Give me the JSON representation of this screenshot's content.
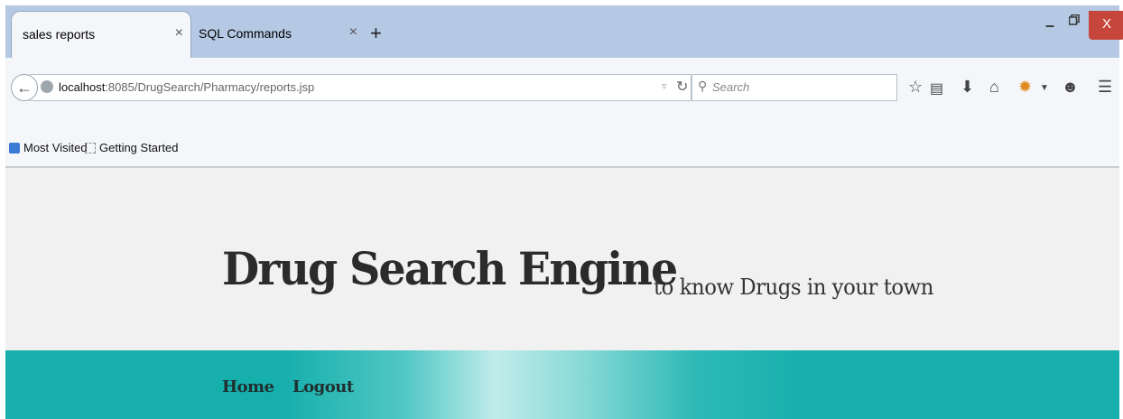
{
  "tabs": [
    {
      "label": "sales reports",
      "close": "×"
    },
    {
      "label": "SQL Commands",
      "close": "×"
    }
  ],
  "new_tab_label": "+",
  "window_controls": {
    "close": "X"
  },
  "nav": {
    "url_host": "localhost",
    "url_rest": ":8085/DrugSearch/Pharmacy/reports.jsp",
    "search_placeholder": "Search"
  },
  "bookmarks": [
    {
      "label": "Most Visited",
      "icon": "most-visited-icon"
    },
    {
      "label": "Getting Started",
      "icon": "page-icon"
    }
  ],
  "site": {
    "title": "Drug Search Engine",
    "tagline": "to know Drugs in your town"
  },
  "menu": [
    {
      "label": "Home"
    },
    {
      "label": "Logout"
    }
  ],
  "colors": {
    "menu_bar": "#16afac",
    "close_button": "#c7463b",
    "tab_strip": "#b5c9e4"
  }
}
